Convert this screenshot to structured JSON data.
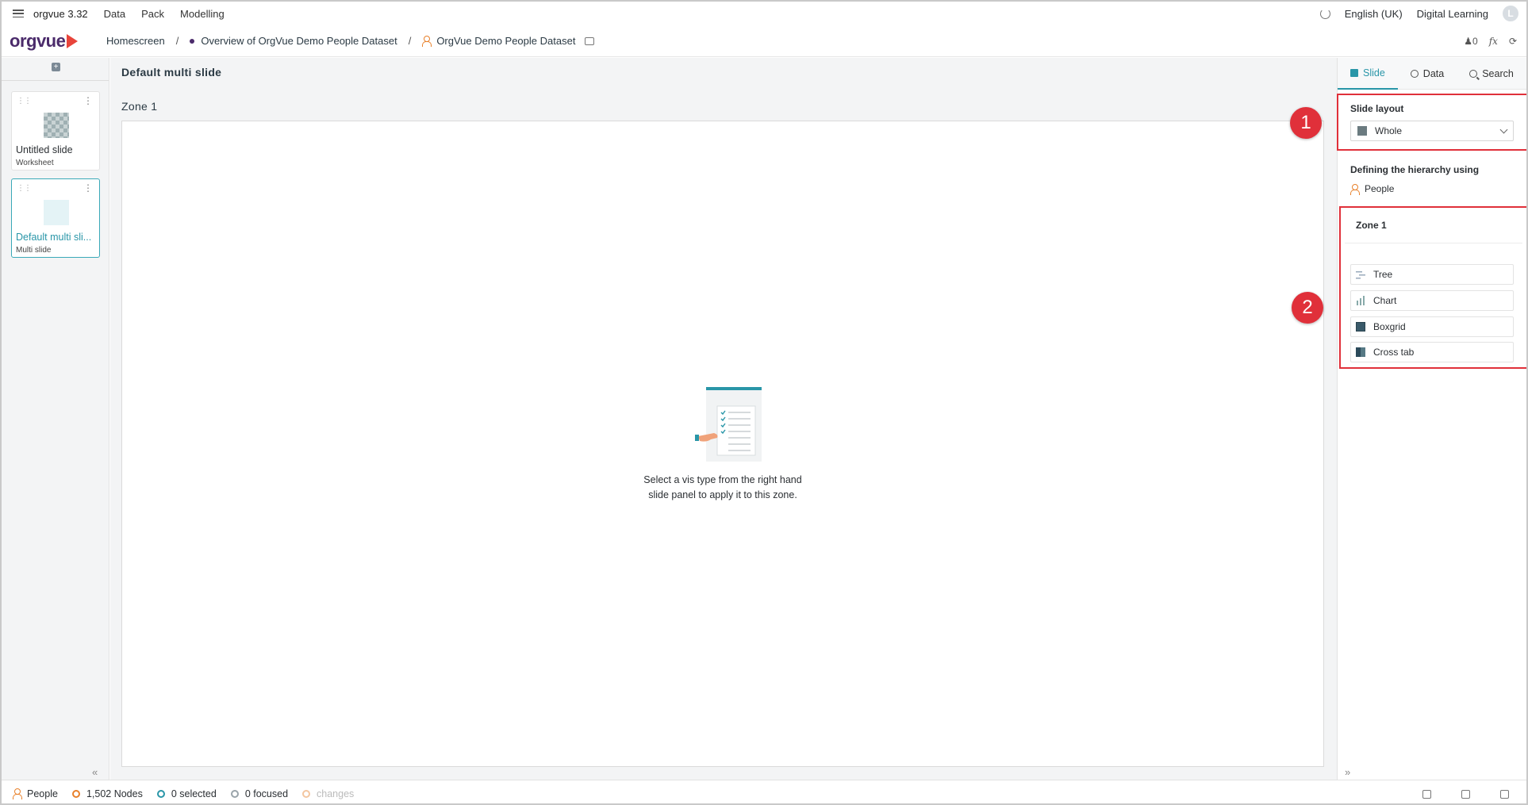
{
  "menubar": {
    "app_title": "orgvue 3.32",
    "items": [
      "Data",
      "Pack",
      "Modelling"
    ],
    "language": "English (UK)",
    "workspace": "Digital Learning",
    "avatar_letter": "L"
  },
  "breadcrumb": {
    "logo_text": "orgvue",
    "items": [
      "Homescreen",
      "Overview of OrgVue Demo People Dataset",
      "OrgVue Demo People Dataset"
    ],
    "separator": "/",
    "user_count": "0",
    "fx_label": "fx"
  },
  "slides": [
    {
      "name": "Untitled slide",
      "type": "Worksheet"
    },
    {
      "name": "Default multi sli...",
      "type": "Multi slide"
    }
  ],
  "main": {
    "slide_title": "Default multi slide",
    "zone_title": "Zone 1",
    "empty_line1": "Select a vis type from the right hand",
    "empty_line2": "slide panel to apply it to this zone."
  },
  "right_panel": {
    "tabs": [
      "Slide",
      "Data",
      "Search"
    ],
    "slide_layout_label": "Slide layout",
    "slide_layout_value": "Whole",
    "hierarchy_label": "Defining the hierarchy using",
    "hierarchy_value": "People",
    "zone_label": "Zone 1",
    "vis_types": [
      "Tree",
      "Chart",
      "Boxgrid",
      "Cross tab"
    ]
  },
  "annotations": [
    "1",
    "2"
  ],
  "statusbar": {
    "dataset": "People",
    "nodes": "1,502 Nodes",
    "selected": "0 selected",
    "focused": "0 focused",
    "changes": "changes"
  },
  "colors": {
    "accent": "#2996a8",
    "brand_purple": "#4b2b6b",
    "brand_red": "#e8443a",
    "annotation_red": "#e0303a",
    "person_orange": "#e8802a"
  }
}
